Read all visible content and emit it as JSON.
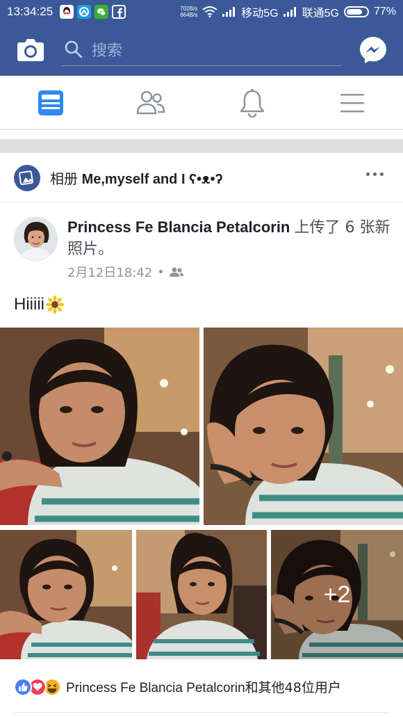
{
  "status_bar": {
    "time": "13:34:25",
    "speed_up": "702B/s",
    "speed_down": "664B/s",
    "carrier1": "移动5G",
    "carrier2": "联通5G",
    "battery": "77%",
    "battery_level": 0.77
  },
  "header": {
    "search_placeholder": "搜索",
    "icons": [
      "camera-icon",
      "search-icon",
      "messenger-icon"
    ]
  },
  "tabs": [
    "news-feed-icon",
    "friends-icon",
    "notifications-icon",
    "menu-icon"
  ],
  "album": {
    "prefix": "相册",
    "name": "Me,myself and I ʕ•ᴥ•ʔ"
  },
  "post": {
    "author": "Princess Fe Blancia Petalcorin",
    "action": "上传了 6 张新照片。",
    "timestamp": "2月12日18:42",
    "separator": "•",
    "text": "Hiiiii",
    "more_photos": "+2"
  },
  "reactions": {
    "icons": [
      "like-icon",
      "love-icon",
      "haha-icon"
    ],
    "names": "Princess Fe Blancia Petalcorin",
    "suffix": "和其他48位用户"
  },
  "colors": {
    "brand": "#3b5998",
    "like": "#4a80f5",
    "love": "#f33e58",
    "haha": "#f7b125"
  }
}
